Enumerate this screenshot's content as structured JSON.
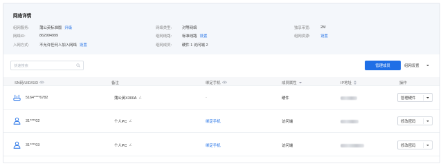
{
  "details": {
    "title": "网络详情",
    "items": [
      {
        "key": "组网服务:",
        "value": "蒲公英标准版",
        "link": "升级"
      },
      {
        "key": "网络类型:",
        "value": "对等网络"
      },
      {
        "key": "独享带宽:",
        "value": "2M"
      },
      {
        "key": "网络ID:",
        "value": "862994999"
      },
      {
        "key": "组网线路:",
        "value": "标准线路",
        "link": "设置"
      },
      {
        "key": "组网资源:",
        "value": "",
        "link": "设置"
      },
      {
        "key": "入网方式:",
        "value": "不允许任何人加入网络",
        "link": "设置"
      },
      {
        "key": "组网成员:",
        "value": "硬件 1  访问端 2"
      }
    ]
  },
  "toolbar": {
    "search_placeholder": "快速搜索",
    "manage_members": "管理成员",
    "network_settings": "组网设置"
  },
  "table": {
    "columns": [
      "SN码/UID/SID",
      "备注",
      "绑定手机",
      "成员属性",
      "IP地址",
      "操作"
    ],
    "rows": [
      {
        "id": "5164****6782",
        "type": "hardware",
        "note": "蒲公英X300A",
        "phone": "-",
        "attr": "硬件",
        "action": "管理硬件"
      },
      {
        "id": "31****02",
        "type": "client",
        "note": "个人PC",
        "phone": "绑定手机",
        "attr": "访问端",
        "action": "修改密码"
      },
      {
        "id": "31****03",
        "type": "client",
        "note": "个人PC",
        "phone": "绑定手机",
        "attr": "访问端",
        "action": "修改密码"
      }
    ]
  },
  "colors": {
    "accent": "#1f6fe6",
    "panel": "#f4f7fb"
  }
}
